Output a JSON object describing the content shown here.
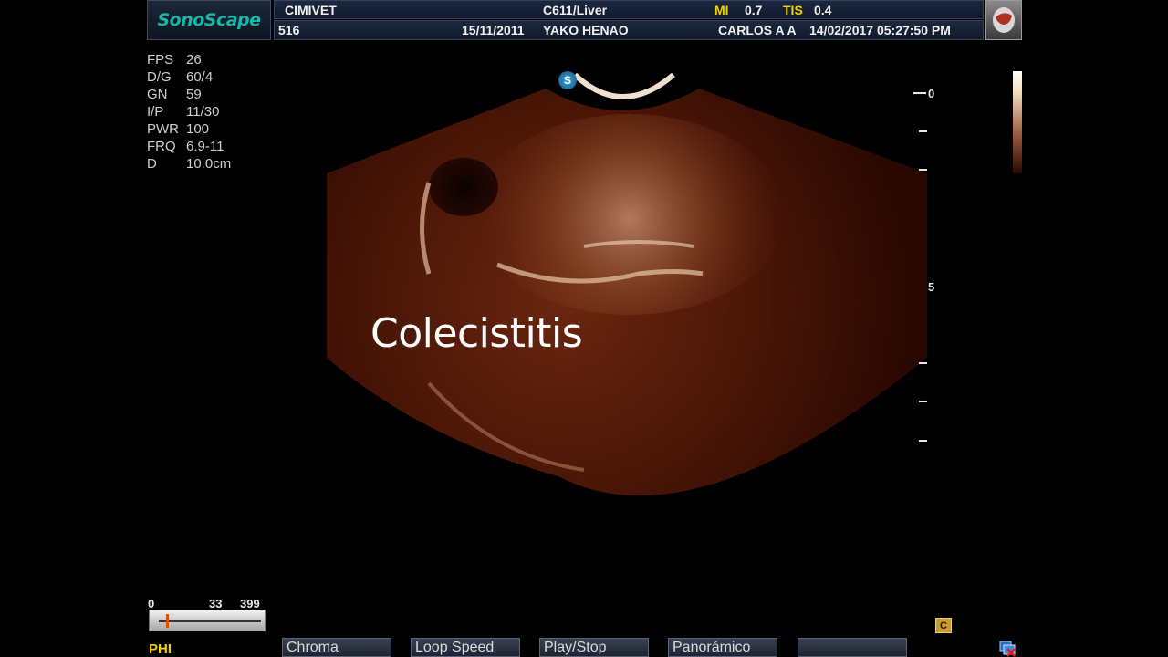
{
  "header": {
    "logo": "SonoScape",
    "institution": "CIMIVET",
    "probe_preset": "C611/Liver",
    "mi_label": "MI",
    "mi_value": "0.7",
    "tis_label": "TIS",
    "tis_value": "0.4",
    "patient_id": "516",
    "patient_dob": "15/11/2011",
    "patient_name": "YAKO HENAO",
    "operator": "CARLOS A A",
    "datetime": "14/02/2017 05:27:50 PM"
  },
  "params": [
    {
      "label": "FPS",
      "value": "26"
    },
    {
      "label": "D/G",
      "value": "60/4"
    },
    {
      "label": "GN",
      "value": "59"
    },
    {
      "label": "I/P",
      "value": "11/30"
    },
    {
      "label": "PWR",
      "value": "100"
    },
    {
      "label": "FRQ",
      "value": "6.9-11"
    },
    {
      "label": "D",
      "value": "10.0cm"
    }
  ],
  "image": {
    "caption": "Colecistitis",
    "probe_marker": "S",
    "depth_labels": {
      "top": "0",
      "mid": "5"
    }
  },
  "cine": {
    "start": "0",
    "current": "33",
    "end": "399",
    "position_fraction": 0.083
  },
  "phi_label": "PHI",
  "softkeys": [
    "Chroma",
    "Loop Speed",
    "Play/Stop",
    "Panorámico",
    ""
  ],
  "c_icon": "C",
  "icons": {
    "thumbnail": "organ-preset-icon",
    "corner": "network-disconnected-icon"
  },
  "colors": {
    "accent_teal": "#19b6a8",
    "highlight_yellow": "#f2d000",
    "tissue_brown": "#5a1a08"
  }
}
